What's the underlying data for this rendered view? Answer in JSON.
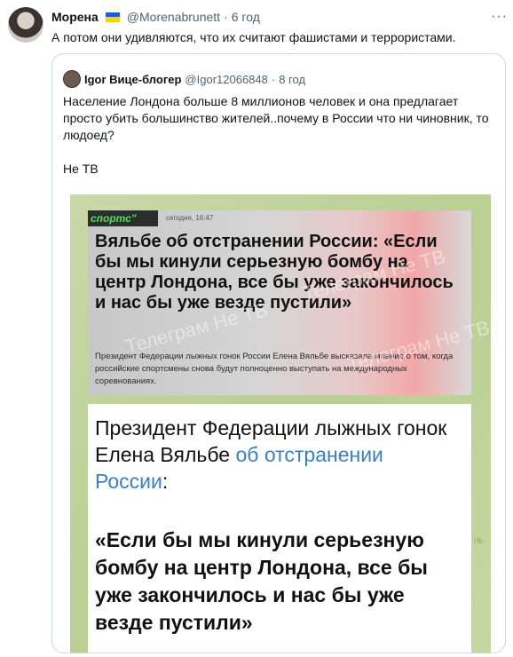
{
  "tweet": {
    "author_name": "Морена",
    "handle": "@Morenabrunett",
    "separator": "·",
    "time": "6 год",
    "more_icon": "more-icon",
    "text": "А потом они удивляются, что их считают фашистами и террористами."
  },
  "quote": {
    "author_name": "Igor Вице-блогер",
    "handle": "@Igor12066848",
    "separator": "·",
    "time": "8 год",
    "text_line1": "Население Лондона больше 8 миллионов человек и она предлагает просто убить большинство жителей..почему в России что ни чиновник, то людоед?",
    "text_line2": "Не ТВ"
  },
  "image": {
    "card1": {
      "logo": "спортс\"",
      "date": "сегодня, 16:47",
      "headline": "Вяльбе об отстранении России: «Если бы мы кинули серьезную бомбу на центр Лондона, все бы уже закончилось и нас бы уже везде пустили»",
      "subtext": "Президент Федерации лыжных гонок России Елена Вяльбе высказала мнение о том, когда российские спортсмены снова будут полноценно выступать на международных соревнованиях.",
      "watermark": "Телеграм Не ТВ"
    },
    "card2": {
      "lead_text": "Президент Федерации лыжных гонок  Елена Вяльбе ",
      "lead_link": "об отстранении России",
      "lead_colon": ":",
      "quote": "«Если бы мы кинули серьезную бомбу на центр Лондона, все бы уже закончилось и нас бы уже везде пустили»"
    }
  },
  "colors": {
    "link": "#3b7fbf",
    "muted": "#536471",
    "border": "#cfd9de"
  }
}
